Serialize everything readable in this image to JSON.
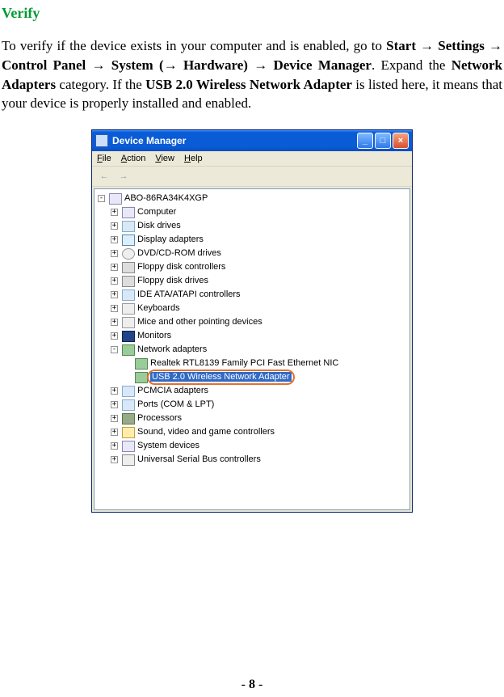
{
  "heading": "Verify",
  "para": {
    "seg1": "To verify if the device exists in your computer and is enabled, go to ",
    "start": "Start",
    "arrow": " → ",
    "settings": "Settings",
    "cp": "Control Panel",
    "system": "System",
    "lparen": " (",
    "hardware": "Hardware",
    "rparen": ")",
    "dm": "Device Manager",
    "seg2": ". Expand the ",
    "na": "Network Adapters",
    "seg3": " category. If the ",
    "usb": "USB 2.0 Wireless Network Adapter",
    "seg4": " is listed here, it means that your device is properly installed and enabled."
  },
  "window": {
    "title": "Device Manager",
    "menu": {
      "file": "File",
      "action": "Action",
      "view": "View",
      "help": "Help"
    },
    "root": "ABO-86RA34K4XGP",
    "items": [
      {
        "label": "Computer",
        "cls": "computer"
      },
      {
        "label": "Disk drives",
        "cls": "dev"
      },
      {
        "label": "Display adapters",
        "cls": "disp"
      },
      {
        "label": "DVD/CD-ROM drives",
        "cls": "cd"
      },
      {
        "label": "Floppy disk controllers",
        "cls": "floppy"
      },
      {
        "label": "Floppy disk drives",
        "cls": "floppy"
      },
      {
        "label": "IDE ATA/ATAPI controllers",
        "cls": "dev"
      },
      {
        "label": "Keyboards",
        "cls": "keyb"
      },
      {
        "label": "Mice and other pointing devices",
        "cls": "mouse"
      },
      {
        "label": "Monitors",
        "cls": "monitor"
      }
    ],
    "network": {
      "label": "Network adapters",
      "cls": "net",
      "children": [
        "Realtek RTL8139 Family PCI Fast Ethernet NIC",
        "USB 2.0 Wireless Network Adapter"
      ]
    },
    "items2": [
      {
        "label": "PCMCIA adapters",
        "cls": "dev"
      },
      {
        "label": "Ports (COM & LPT)",
        "cls": "dev"
      },
      {
        "label": "Processors",
        "cls": "chip"
      },
      {
        "label": "Sound, video and game controllers",
        "cls": "snd"
      },
      {
        "label": "System devices",
        "cls": "computer"
      },
      {
        "label": "Universal Serial Bus controllers",
        "cls": "usb"
      }
    ]
  },
  "pagenum": "- 8 -"
}
